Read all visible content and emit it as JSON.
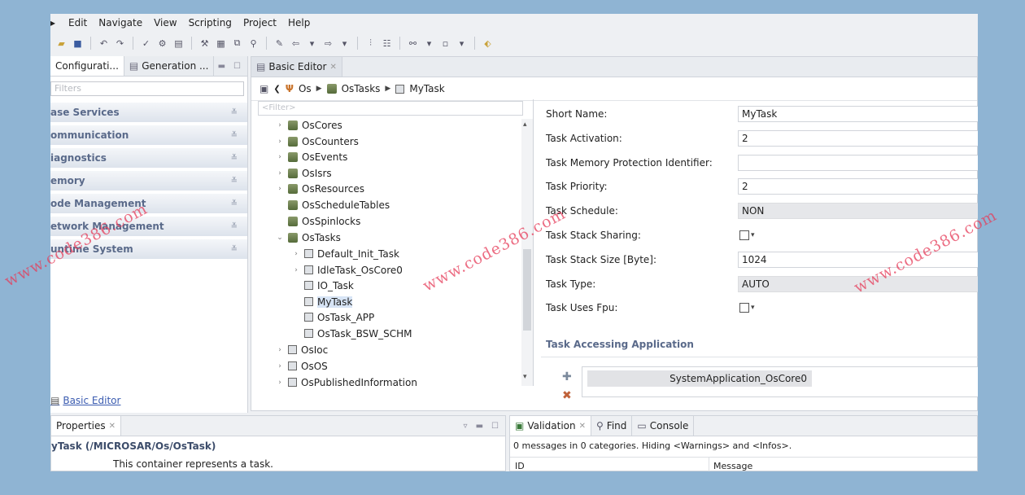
{
  "menu": {
    "items": [
      "Edit",
      "Navigate",
      "View",
      "Scripting",
      "Project",
      "Help"
    ]
  },
  "left_panel": {
    "tabs": [
      "Configurati...",
      "Generation ..."
    ],
    "filter_placeholder": "Filters",
    "categories": [
      "ase Services",
      "ommunication",
      "iagnostics",
      "emory",
      "ode Management",
      "etwork Management",
      "untime System"
    ],
    "basic_editor_link": "Basic Editor"
  },
  "editor": {
    "tab_label": "Basic Editor",
    "breadcrumb": [
      "Os",
      "OsTasks",
      "MyTask"
    ],
    "tree_filter_placeholder": "<Filter>",
    "tree": [
      {
        "label": "OsCores",
        "expander": "›"
      },
      {
        "label": "OsCounters",
        "expander": "›"
      },
      {
        "label": "OsEvents",
        "expander": "›"
      },
      {
        "label": "OsIsrs",
        "expander": "›"
      },
      {
        "label": "OsResources",
        "expander": "›"
      },
      {
        "label": "OsScheduleTables",
        "expander": ""
      },
      {
        "label": "OsSpinlocks",
        "expander": ""
      },
      {
        "label": "OsTasks",
        "expander": "⌄"
      },
      {
        "label": "Default_Init_Task",
        "expander": "›"
      },
      {
        "label": "IdleTask_OsCore0",
        "expander": "›"
      },
      {
        "label": "IO_Task",
        "expander": ""
      },
      {
        "label": "MyTask",
        "expander": ""
      },
      {
        "label": "OsTask_APP",
        "expander": ""
      },
      {
        "label": "OsTask_BSW_SCHM",
        "expander": ""
      },
      {
        "label": "OsIoc",
        "expander": "›"
      },
      {
        "label": "OsOS",
        "expander": "›"
      },
      {
        "label": "OsPublishedInformation",
        "expander": "›"
      }
    ],
    "form": {
      "short_name": {
        "label": "Short Name:",
        "value": "MyTask"
      },
      "task_activation": {
        "label": "Task Activation:",
        "value": "2"
      },
      "task_mem_protection": {
        "label": "Task Memory Protection Identifier:",
        "value": ""
      },
      "task_priority": {
        "label": "Task Priority:",
        "value": "2"
      },
      "task_schedule": {
        "label": "Task Schedule:",
        "value": "NON"
      },
      "task_stack_sharing": {
        "label": "Task Stack Sharing:"
      },
      "task_stack_size": {
        "label": "Task Stack Size [Byte]:",
        "value": "1024"
      },
      "task_type": {
        "label": "Task Type:",
        "value": "AUTO"
      },
      "task_uses_fpu": {
        "label": "Task Uses Fpu:"
      },
      "accessing_section": "Task Accessing Application",
      "accessing_item": "SystemApplication_OsCore0"
    }
  },
  "properties": {
    "tab_label": "Properties",
    "title": "yTask (/MICROSAR/Os/OsTask)",
    "description": "This container represents a task."
  },
  "validation": {
    "tabs": [
      "Validation",
      "Find",
      "Console"
    ],
    "message": "0 messages in 0 categories. Hiding <Warnings> and <Infos>.",
    "columns": [
      "ID",
      "Message"
    ]
  },
  "watermark": "www.code386.com"
}
